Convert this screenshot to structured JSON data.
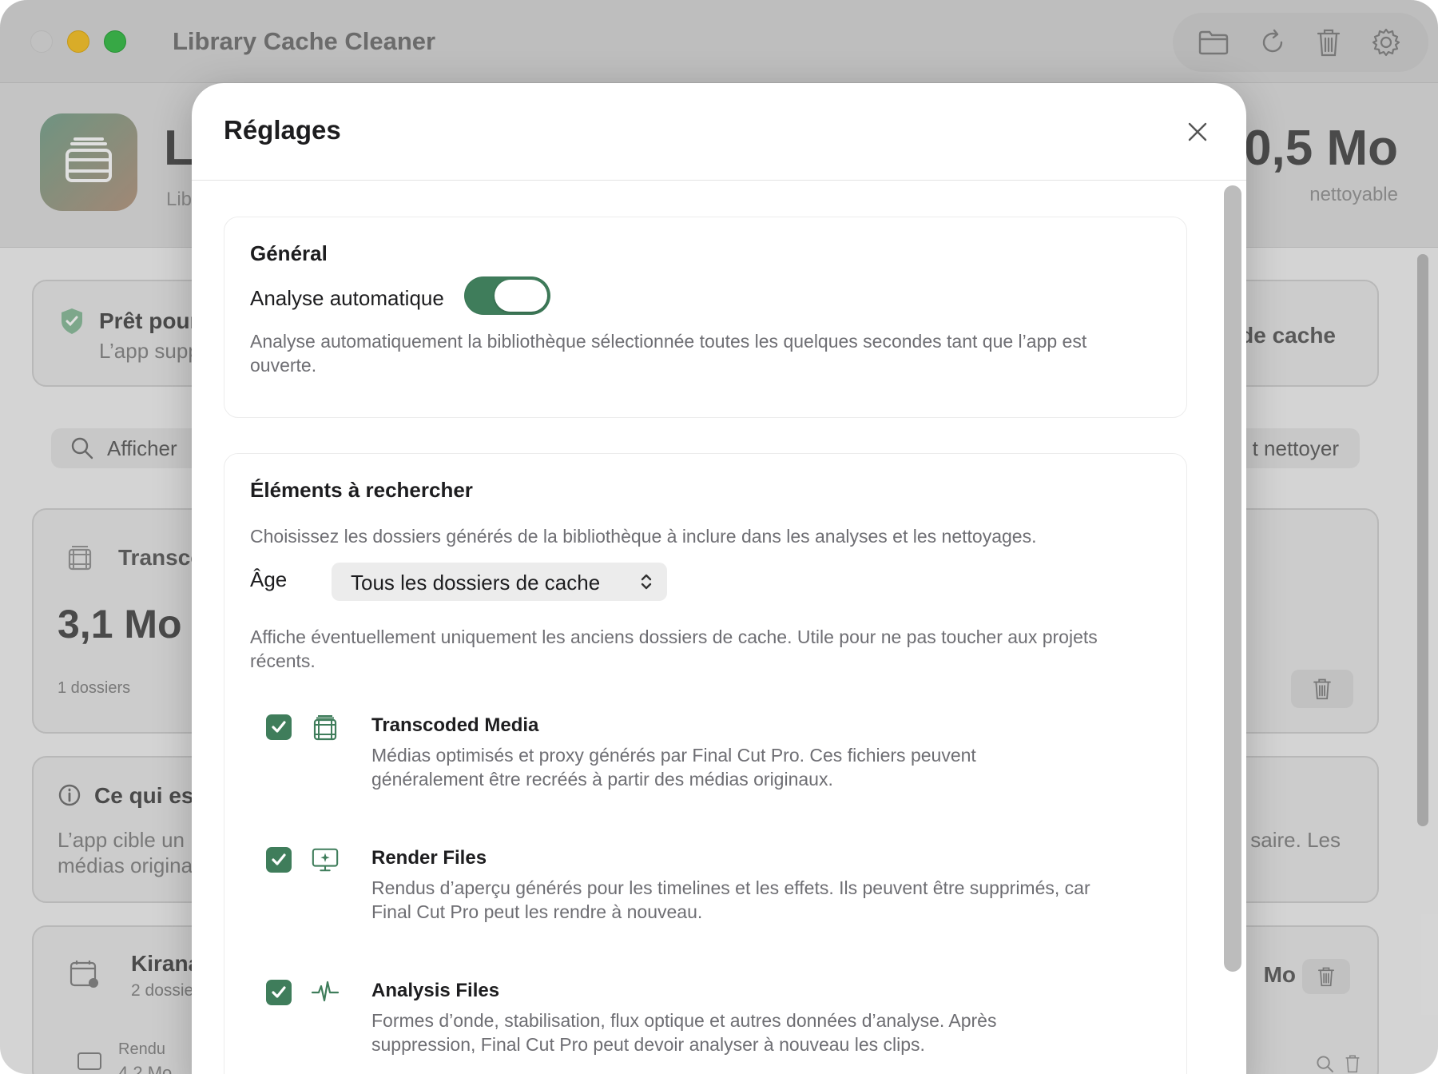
{
  "window": {
    "title": "Library Cache Cleaner",
    "toolbar_icons": [
      "folder-icon",
      "refresh-icon",
      "trash-icon",
      "gear-icon"
    ]
  },
  "background": {
    "header_big_letter": "L",
    "header_sub": "Lib",
    "header_size": "0,5 Mo",
    "header_size_label": "nettoyable",
    "status_title": "Prêt pour",
    "status_sub": "L’app supp",
    "status_right": "de cache",
    "search_text": "Afficher",
    "clean_text": "t nettoyer",
    "transcode_title": "Transco",
    "transcode_size": "3,1 Mo",
    "transcode_count": "1 dossiers",
    "info_title": "Ce qui est",
    "info_line1": "L’app cible un",
    "info_line2": "médias origina",
    "info_right": "saire. Les",
    "library_title": "Kirana",
    "library_sub": "2 dossie",
    "library_size": "Mo",
    "rendu_label": "Rendu",
    "rendu_size": "4,2 Mo"
  },
  "settings": {
    "title": "Réglages",
    "general": {
      "title": "Général",
      "auto_label": "Analyse automatique",
      "auto_enabled": true,
      "auto_desc": "Analyse automatiquement la bibliothèque sélectionnée toutes les quelques secondes tant que l’app est ouverte."
    },
    "elements": {
      "title": "Éléments à rechercher",
      "desc": "Choisissez les dossiers générés de la bibliothèque à inclure dans les analyses et les nettoyages.",
      "age_label": "Âge",
      "age_value": "Tous les dossiers de cache",
      "age_desc": "Affiche éventuellement uniquement les anciens dossiers de cache. Utile pour ne pas toucher aux projets récents.",
      "items": [
        {
          "title": "Transcoded Media",
          "desc": "Médias optimisés et proxy générés par Final Cut Pro. Ces fichiers peuvent généralement être recréés à partir des médias originaux.",
          "checked": true,
          "icon": "film-icon"
        },
        {
          "title": "Render Files",
          "desc": "Rendus d’aperçu générés pour les timelines et les effets. Ils peuvent être supprimés, car Final Cut Pro peut les rendre à nouveau.",
          "checked": true,
          "icon": "render-monitor-icon"
        },
        {
          "title": "Analysis Files",
          "desc": "Formes d’onde, stabilisation, flux optique et autres données d’analyse. Après suppression, Final Cut Pro peut devoir analyser à nouveau les clips.",
          "checked": true,
          "icon": "waveform-icon"
        }
      ]
    }
  },
  "colors": {
    "accent": "#3f7d5b",
    "text": "#1d1d1f",
    "secondary_text": "#6e6e73"
  }
}
